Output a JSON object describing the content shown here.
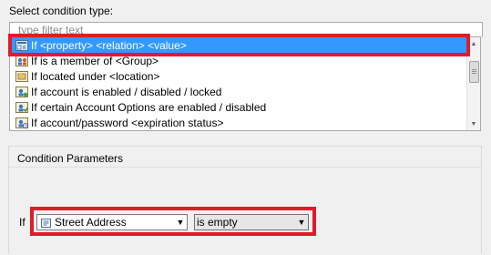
{
  "condition_section": {
    "label": "Select condition type:",
    "filter_placeholder": "type filter text",
    "items": [
      {
        "label": "If <property> <relation> <value>",
        "icon": "property-condition-icon",
        "selected": true
      },
      {
        "label": "If is a member of <Group>",
        "icon": "group-member-icon",
        "selected": false
      },
      {
        "label": "If located under <location>",
        "icon": "location-icon",
        "selected": false
      },
      {
        "label": "If account is enabled / disabled / locked",
        "icon": "account-status-icon",
        "selected": false
      },
      {
        "label": "If certain Account Options are enabled / disabled",
        "icon": "account-options-icon",
        "selected": false
      },
      {
        "label": "If account/password <expiration status>",
        "icon": "expiration-icon",
        "selected": false
      }
    ]
  },
  "parameters": {
    "title": "Condition Parameters",
    "if_label": "If",
    "property_value": "Street Address",
    "property_icon": "field-icon",
    "relation_value": "is empty"
  },
  "colors": {
    "selection": "#3399ff",
    "highlight": "#e01b2a"
  }
}
